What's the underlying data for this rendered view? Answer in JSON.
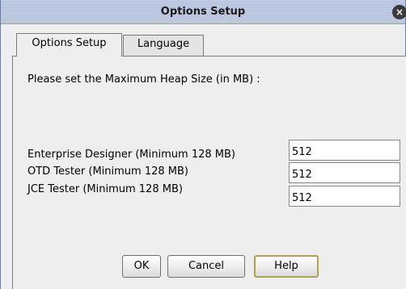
{
  "window": {
    "title": "Options Setup",
    "close_glyph": "×"
  },
  "tabs": [
    {
      "label": "Options Setup",
      "active": true
    },
    {
      "label": "Language",
      "active": false
    }
  ],
  "panel": {
    "prompt": "Please set the Maximum Heap Size (in MB) :",
    "fields": [
      {
        "label": "Enterprise Designer (Minimum 128 MB)",
        "value": "512"
      },
      {
        "label": "OTD Tester (Minimum 128 MB)",
        "value": "512"
      },
      {
        "label": "JCE Tester (Minimum 128 MB)",
        "value": "512"
      }
    ]
  },
  "buttons": {
    "ok": "OK",
    "cancel": "Cancel",
    "help": "Help"
  }
}
